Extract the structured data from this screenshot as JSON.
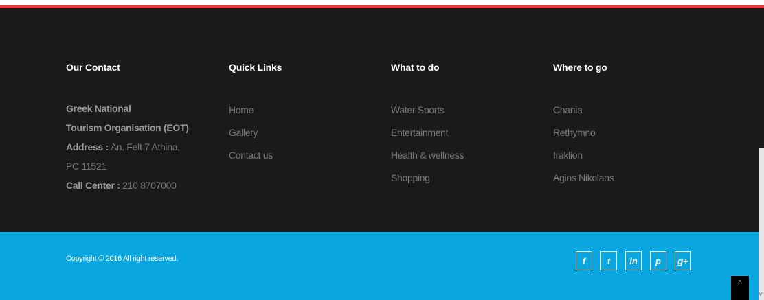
{
  "colors": {
    "accent_red": "#e8393e",
    "footer_bg": "#1a1a1a",
    "copyright_bg": "#0aa6e0"
  },
  "contact": {
    "heading": "Our Contact",
    "org_line1": "Greek National",
    "org_line2": "Tourism Organisation (EOT)",
    "address_label": "Address :",
    "address_value": " An. Felt 7 Athina,",
    "address_line2": "PC 11521",
    "call_label": "Call Center :",
    "call_value": " 210 8707000"
  },
  "quick_links": {
    "heading": "Quick Links",
    "items": [
      "Home",
      "Gallery",
      "Contact us"
    ]
  },
  "what_to_do": {
    "heading": "What to do",
    "items": [
      "Water Sports",
      "Entertainment",
      "Health & wellness",
      "Shopping"
    ]
  },
  "where_to_go": {
    "heading": "Where to go",
    "items": [
      "Chania",
      "Rethymno",
      "Iraklion",
      "Agios Nikolaos"
    ]
  },
  "copyright": "Copyright © 2016 All right reserved.",
  "socials": [
    {
      "icon": "facebook-icon",
      "glyph": "f"
    },
    {
      "icon": "twitter-icon",
      "glyph": "t"
    },
    {
      "icon": "linkedin-icon",
      "glyph": "in"
    },
    {
      "icon": "pinterest-icon",
      "glyph": "p"
    },
    {
      "icon": "google-plus-icon",
      "glyph": "g+"
    }
  ],
  "back_to_top": "^"
}
